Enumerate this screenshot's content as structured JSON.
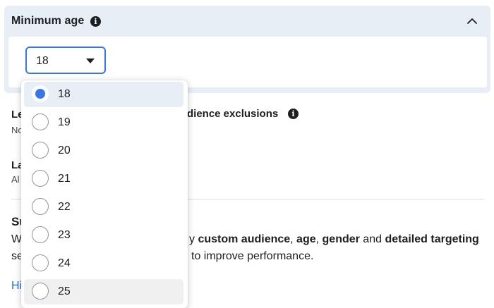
{
  "section": {
    "title": "Minimum age",
    "selected_value": "18"
  },
  "background": {
    "row1_title_fragment": "Le",
    "row1_sub_fragment": "No",
    "row1_right_text": "dience exclusions",
    "row2_title_fragment": "La",
    "row2_sub_fragment": "Al",
    "row3_title_fragment": "Su",
    "row3_line1_prefix": "W",
    "row3_line2_prefix": "se",
    "desc_line1": {
      "part1": "y ",
      "part2": "custom audience",
      "part3": ", ",
      "part4": "age",
      "part5": ", ",
      "part6": "gender",
      "part7": " and ",
      "part8": "detailed targeting"
    },
    "desc_line2": "to improve performance.",
    "link_fragment": "Hi"
  },
  "dropdown": {
    "options": [
      {
        "label": "18",
        "checked": true
      },
      {
        "label": "19",
        "checked": false
      },
      {
        "label": "20",
        "checked": false
      },
      {
        "label": "21",
        "checked": false
      },
      {
        "label": "22",
        "checked": false
      },
      {
        "label": "23",
        "checked": false
      },
      {
        "label": "24",
        "checked": false
      },
      {
        "label": "25",
        "checked": false
      }
    ]
  },
  "colors": {
    "accent": "#3578e5",
    "panel_bg": "#e7eef6",
    "link": "#216fdb"
  },
  "icons": {
    "info": "info-icon",
    "collapse": "chevron-up-icon",
    "dropdown": "caret-down-icon"
  }
}
